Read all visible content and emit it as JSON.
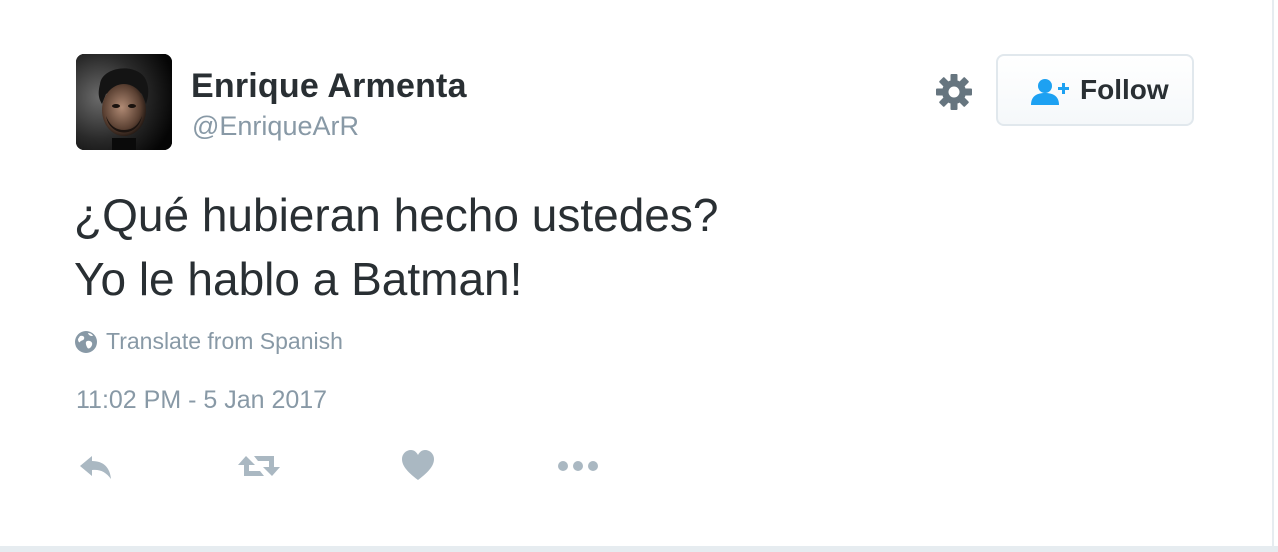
{
  "user": {
    "display_name": "Enrique Armenta",
    "handle": "@EnriqueArR",
    "avatar_icon": "profile-photo"
  },
  "header": {
    "settings_icon": "gear-icon",
    "follow_label": "Follow",
    "follow_icon": "follow-user-icon"
  },
  "tweet": {
    "lines": [
      "¿Qué hubieran hecho ustedes?",
      "Yo le hablo a Batman!"
    ],
    "translate_label": "Translate from Spanish",
    "translate_icon": "globe-icon",
    "timestamp": "11:02 PM - 5 Jan 2017"
  },
  "actions": {
    "reply_icon": "reply-icon",
    "retweet_icon": "retweet-icon",
    "like_icon": "heart-icon",
    "more_icon": "more-icon"
  },
  "colors": {
    "text_primary": "#292f33",
    "text_secondary": "#8899a6",
    "icon_gray": "#aab8c2",
    "accent": "#1da1f2",
    "border": "#e1e8ed"
  }
}
